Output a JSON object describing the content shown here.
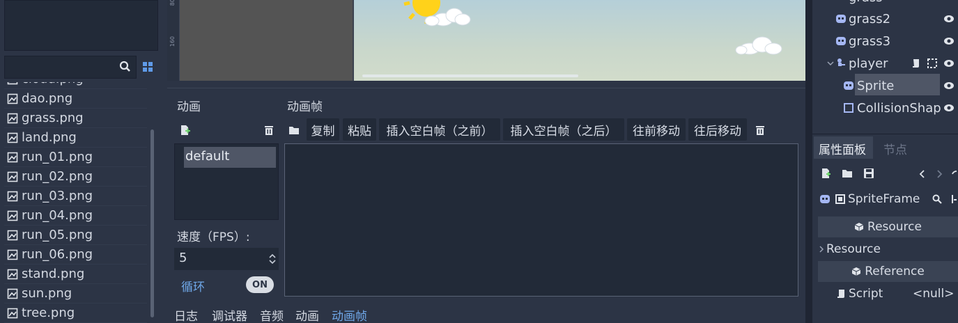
{
  "filesystem": {
    "search_placeholder": "",
    "files": [
      "cloud.png",
      "dao.png",
      "grass.png",
      "land.png",
      "run_01.png",
      "run_02.png",
      "run_03.png",
      "run_04.png",
      "run_05.png",
      "run_06.png",
      "stand.png",
      "sun.png",
      "tree.png"
    ]
  },
  "viewport": {
    "ruler_marks": [
      "80",
      "160"
    ]
  },
  "animation_panel": {
    "animations_label": "动画",
    "frames_label": "动画帧",
    "anim_items": [
      "default"
    ],
    "toolbar": {
      "copy": "复制",
      "paste": "粘贴",
      "insert_before": "插入空白帧（之前）",
      "insert_after": "插入空白帧（之后）",
      "move_forward": "往前移动",
      "move_back": "往后移动"
    },
    "speed_label": "速度（FPS）:",
    "fps_value": "5",
    "loop_label": "循环",
    "loop_toggle": "ON"
  },
  "bottom_tabs": [
    "日志",
    "调试器",
    "音频",
    "动画",
    "动画帧"
  ],
  "active_bottom_tab": "动画帧",
  "scene_tree": {
    "partial_top": "grass",
    "nodes": [
      {
        "name": "grass2",
        "type": "sprite"
      },
      {
        "name": "grass3",
        "type": "sprite"
      },
      {
        "name": "player",
        "type": "kinematic"
      },
      {
        "name": "Sprite",
        "type": "animated-sprite"
      },
      {
        "name": "CollisionShap",
        "type": "collision"
      }
    ]
  },
  "inspector": {
    "tab_inspector": "属性面板",
    "tab_node": "节点",
    "resource_name": "SpriteFrame",
    "section_resource": "Resource",
    "group_resource": "Resource",
    "section_reference": "Reference",
    "script_label": "Script",
    "script_value": "<null>"
  },
  "colors": {
    "accent": "#6fa7e8",
    "panel_bg": "#2c3445",
    "field_bg": "#222a38",
    "selection": "#4f5666"
  }
}
